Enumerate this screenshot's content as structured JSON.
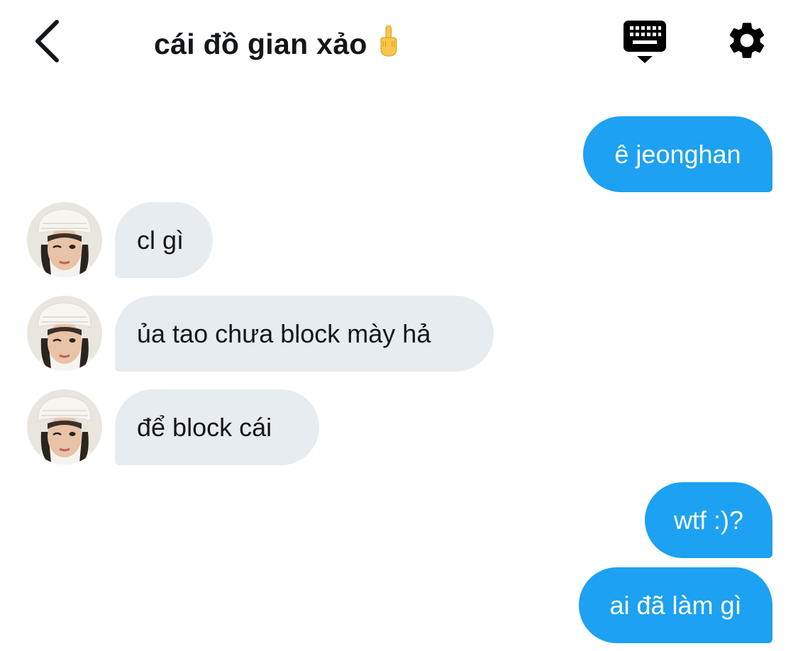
{
  "header": {
    "title": "cái đồ gian xảo",
    "title_emoji": "🖕"
  },
  "icons": {
    "back": "chevron-left-icon",
    "keyboard": "keyboard-icon",
    "settings": "gear-icon",
    "title_emoji": "middle-finger-emoji-icon"
  },
  "colors": {
    "outgoing_bubble": "#1da1f2",
    "incoming_bubble": "#e6ecf0",
    "text_dark": "#14171a"
  },
  "messages": [
    {
      "direction": "outgoing",
      "text": "ê jeonghan"
    },
    {
      "direction": "incoming",
      "text": "cl gì"
    },
    {
      "direction": "incoming",
      "text": "ủa tao chưa block mày hả"
    },
    {
      "direction": "incoming",
      "text": "để block cái"
    },
    {
      "direction": "outgoing",
      "text": "wtf :)?"
    },
    {
      "direction": "outgoing",
      "text": "ai đã làm gì"
    }
  ]
}
